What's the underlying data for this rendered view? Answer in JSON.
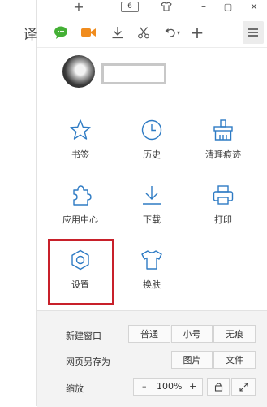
{
  "titlebar": {
    "new_tab_glyph": "+",
    "tab_count": "6",
    "minimize_glyph": "–",
    "maximize_glyph": "▢",
    "close_glyph": "✕"
  },
  "toolbar": {
    "translate_label": "译",
    "undo_caret": "▾",
    "add_glyph": "+"
  },
  "grid": {
    "bookmarks": "书签",
    "history": "历史",
    "clear_traces": "清理痕迹",
    "app_center": "应用中心",
    "downloads": "下载",
    "print": "打印",
    "settings": "设置",
    "skins": "换肤"
  },
  "bottom": {
    "new_window_label": "新建窗口",
    "normal": "普通",
    "small": "小号",
    "traceless": "无痕",
    "save_as_label": "网页另存为",
    "image": "图片",
    "file": "文件",
    "zoom_label": "缩放",
    "zoom_minus": "–",
    "zoom_value": "100%",
    "zoom_plus": "+"
  },
  "colors": {
    "accent": "#2e7bc4",
    "highlight": "#c8202a",
    "wechat": "#44b035",
    "video": "#f08c1e"
  }
}
